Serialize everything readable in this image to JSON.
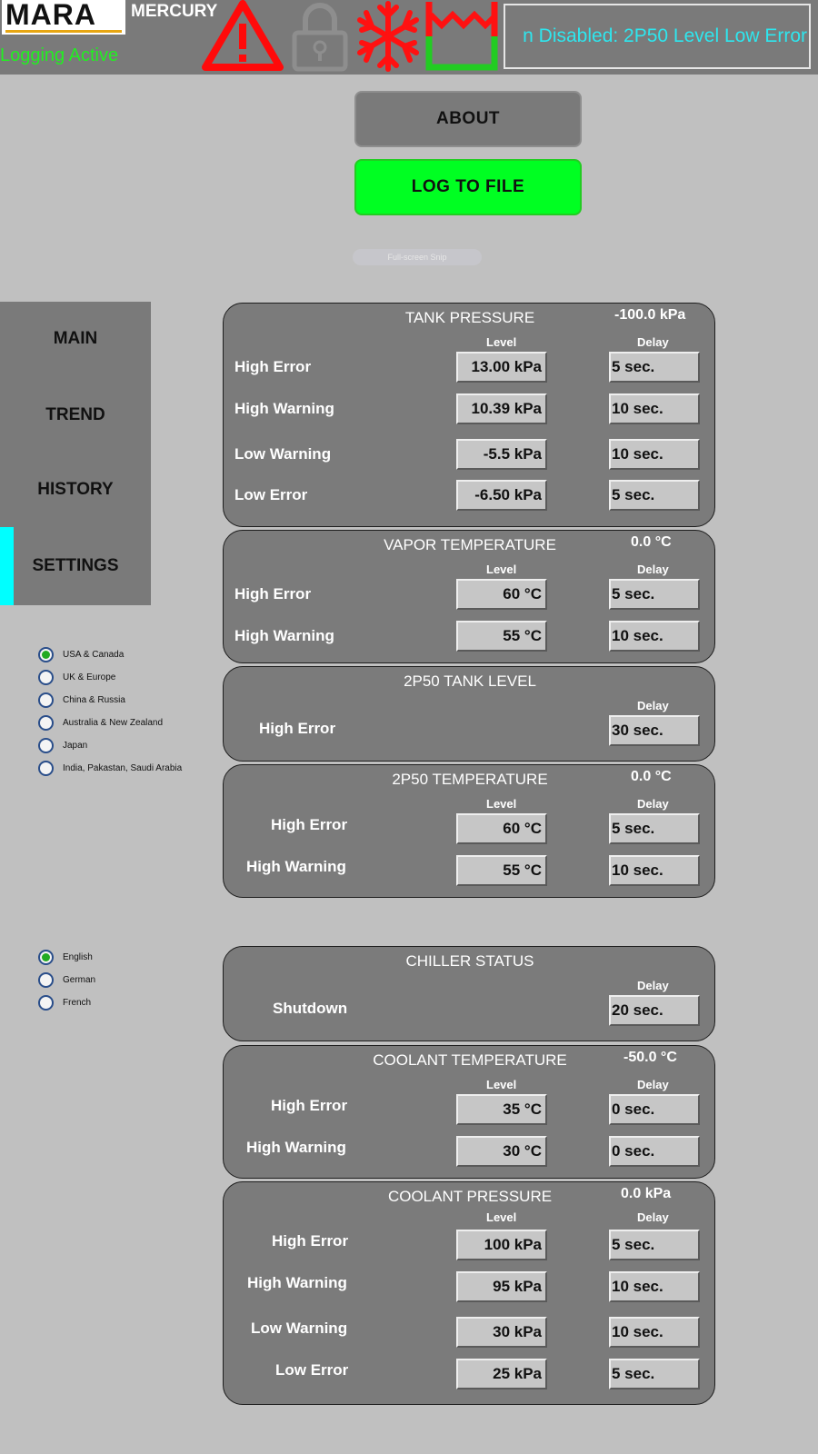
{
  "header": {
    "logo_text": "MARA",
    "product_name": "MERCURY",
    "logging_status": "Logging Active",
    "ticker_text": "n Disabled: 2P50 Level Low Error",
    "icons": [
      "warning-icon",
      "lock-icon",
      "snowflake-icon",
      "tank-level-icon"
    ],
    "colors": {
      "warning": "#ff0a0a",
      "ticker": "#2ee6ee",
      "logging": "#22ee22",
      "tank_outline": "#22cc22"
    }
  },
  "buttons": {
    "about": "ABOUT",
    "log_to_file": "LOG TO FILE",
    "snip_tag": "Full-screen Snip"
  },
  "nav": {
    "items": [
      "MAIN",
      "TREND",
      "HISTORY",
      "SETTINGS"
    ],
    "active": "SETTINGS",
    "active_color": "#00ffff"
  },
  "regions": {
    "options": [
      "USA & Canada",
      "UK & Europe",
      "China & Russia",
      "Australia & New Zealand",
      "Japan",
      "India, Pakastan, Saudi Arabia"
    ],
    "selected": "USA & Canada"
  },
  "languages": {
    "options": [
      "English",
      "German",
      "French"
    ],
    "selected": "English"
  },
  "panels": [
    {
      "title": "TANK PRESSURE",
      "reading": "-100.0 kPa",
      "level_head": "Level",
      "delay_head": "Delay",
      "rows": [
        {
          "label": "High Error",
          "level": "13.00 kPa",
          "delay": "5 sec."
        },
        {
          "label": "High Warning",
          "level": "10.39 kPa",
          "delay": "10 sec."
        },
        {
          "label": "Low Warning",
          "level": "-5.5 kPa",
          "delay": "10 sec."
        },
        {
          "label": "Low Error",
          "level": "-6.50 kPa",
          "delay": "5 sec."
        }
      ]
    },
    {
      "title": "VAPOR TEMPERATURE",
      "reading": "0.0 °C",
      "level_head": "Level",
      "delay_head": "Delay",
      "rows": [
        {
          "label": "High Error",
          "level": "60 °C",
          "delay": "5 sec."
        },
        {
          "label": "High Warning",
          "level": "55 °C",
          "delay": "10 sec."
        }
      ]
    },
    {
      "title": "2P50 TANK LEVEL",
      "reading": "",
      "level_head": "",
      "delay_head": "Delay",
      "rows": [
        {
          "label": "High Error",
          "level": "",
          "delay": "30 sec."
        }
      ]
    },
    {
      "title": "2P50 TEMPERATURE",
      "reading": "0.0 °C",
      "level_head": "Level",
      "delay_head": "Delay",
      "rows": [
        {
          "label": "High Error",
          "level": "60 °C",
          "delay": "5 sec."
        },
        {
          "label": "High Warning",
          "level": "55 °C",
          "delay": "10 sec."
        }
      ]
    },
    {
      "title": "CHILLER STATUS",
      "reading": "",
      "level_head": "",
      "delay_head": "Delay",
      "rows": [
        {
          "label": "Shutdown",
          "level": "",
          "delay": "20 sec."
        }
      ]
    },
    {
      "title": "COOLANT TEMPERATURE",
      "reading": "-50.0 °C",
      "level_head": "Level",
      "delay_head": "Delay",
      "rows": [
        {
          "label": "High Error",
          "level": "35 °C",
          "delay": "0 sec."
        },
        {
          "label": "High Warning",
          "level": "30 °C",
          "delay": "0 sec."
        }
      ]
    },
    {
      "title": "COOLANT PRESSURE",
      "reading": "0.0 kPa",
      "level_head": "Level",
      "delay_head": "Delay",
      "rows": [
        {
          "label": "High Error",
          "level": "100 kPa",
          "delay": "5 sec."
        },
        {
          "label": "High Warning",
          "level": "95 kPa",
          "delay": "10 sec."
        },
        {
          "label": "Low Warning",
          "level": "30 kPa",
          "delay": "10 sec."
        },
        {
          "label": "Low Error",
          "level": "25 kPa",
          "delay": "5 sec."
        }
      ]
    }
  ]
}
